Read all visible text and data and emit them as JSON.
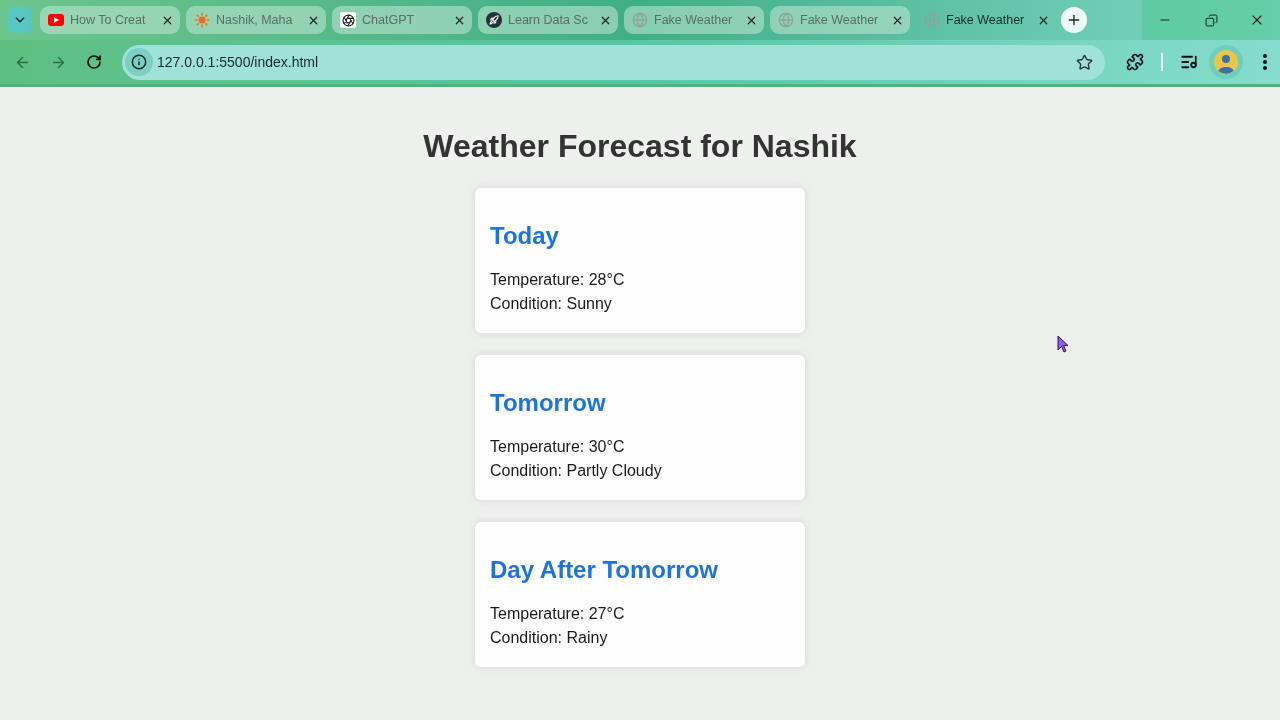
{
  "browser": {
    "tabs": [
      {
        "kind": "video",
        "title": "How To Creat",
        "selected": false
      },
      {
        "kind": "sun",
        "title": "Nashik, Maha",
        "selected": false
      },
      {
        "kind": "chat",
        "title": "ChatGPT",
        "selected": false
      },
      {
        "kind": "rocket",
        "title": "Learn Data Sc",
        "selected": false
      },
      {
        "kind": "globe",
        "title": "Fake Weather",
        "selected": false
      },
      {
        "kind": "globe",
        "title": "Fake Weather",
        "selected": false
      },
      {
        "kind": "globe",
        "title": "Fake Weather",
        "selected": true
      }
    ],
    "address_bar": {
      "url": "127.0.0.1:5500/index.html"
    }
  },
  "page": {
    "title": "Weather Forecast for Nashik",
    "cards": [
      {
        "day": "Today",
        "temperature": "Temperature: 28°C",
        "condition": "Condition: Sunny"
      },
      {
        "day": "Tomorrow",
        "temperature": "Temperature: 30°C",
        "condition": "Condition: Partly Cloudy"
      },
      {
        "day": "Day After Tomorrow",
        "temperature": "Temperature: 27°C",
        "condition": "Condition: Rainy"
      }
    ]
  }
}
